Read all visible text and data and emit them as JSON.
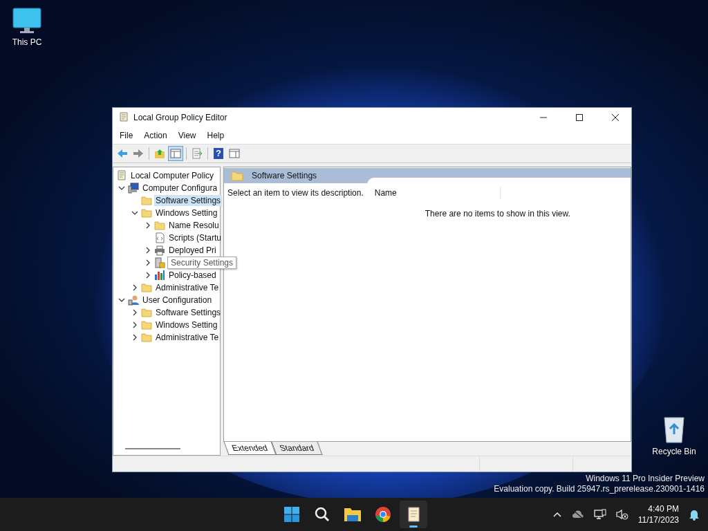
{
  "desktop_icons": [
    {
      "label": "This PC",
      "kind": "monitor"
    },
    {
      "label": "Recycle Bin",
      "kind": "bin"
    }
  ],
  "window": {
    "title": "Local Group Policy Editor",
    "controls": [
      {
        "kind": "minimize"
      },
      {
        "kind": "maximize"
      },
      {
        "kind": "close"
      }
    ]
  },
  "menu": [
    "File",
    "Action",
    "View",
    "Help"
  ],
  "toolbar": [
    [
      {
        "kind": "back",
        "pressed": false
      },
      {
        "kind": "forward",
        "pressed": false
      }
    ],
    [
      {
        "kind": "up",
        "pressed": false
      },
      {
        "kind": "tree",
        "pressed": true
      }
    ],
    [
      {
        "kind": "export",
        "pressed": false
      }
    ],
    [
      {
        "kind": "help",
        "label": "?",
        "pressed": false
      },
      {
        "kind": "pane",
        "pressed": false
      }
    ]
  ],
  "tree": [
    {
      "label": "Local Computer Policy",
      "kind": "policy",
      "selected": false,
      "children": [
        {
          "label": "Computer Configura",
          "kind": "computer",
          "expanded": true,
          "selected": false,
          "children": [
            {
              "label": "Software Settings",
              "kind": "folder",
              "selected": true
            },
            {
              "label": "Windows Setting",
              "kind": "folder",
              "expanded": true,
              "selected": false,
              "children": [
                {
                  "label": "Name Resolu",
                  "kind": "folder",
                  "expanded": false,
                  "selected": false
                },
                {
                  "label": "Scripts (Startu",
                  "kind": "scripts",
                  "selected": false
                },
                {
                  "label": "Deployed Pri",
                  "kind": "printer",
                  "expanded": false,
                  "selected": false
                },
                {
                  "tooltip": "Security Settings",
                  "kind": "security",
                  "expanded": false,
                  "selected": false
                },
                {
                  "label": "Policy-based",
                  "kind": "chart",
                  "expanded": false,
                  "selected": false
                }
              ]
            },
            {
              "label": "Administrative Te",
              "kind": "folder",
              "expanded": false,
              "selected": false
            }
          ]
        },
        {
          "label": "User Configuration",
          "kind": "user",
          "expanded": true,
          "selected": false,
          "children": [
            {
              "label": "Software Settings",
              "kind": "folder",
              "expanded": false,
              "selected": false
            },
            {
              "label": "Windows Setting",
              "kind": "folder",
              "expanded": false,
              "selected": false
            },
            {
              "label": "Administrative Te",
              "kind": "folder",
              "expanded": false,
              "selected": false
            }
          ]
        }
      ]
    }
  ],
  "detail": {
    "header": "Software Settings",
    "description": "Select an item to view its description.",
    "columns": [
      "Name"
    ],
    "empty_message": "There are no items to show in this view."
  },
  "view_tabs": [
    {
      "label": "Extended",
      "selected": true
    },
    {
      "label": "Standard",
      "selected": false
    }
  ],
  "watermark": {
    "line_1": "Windows 11 Pro Insider Preview",
    "line_2": "Evaluation copy. Build 25947.rs_prerelease.230901-1416"
  },
  "taskbar": {
    "apps": [
      {
        "kind": "start",
        "active": false
      },
      {
        "kind": "search",
        "active": false
      },
      {
        "kind": "explorer",
        "active": false
      },
      {
        "kind": "chrome",
        "active": false
      },
      {
        "kind": "gpedit",
        "active": true
      }
    ],
    "tray": [
      {
        "kind": "chevron"
      },
      {
        "kind": "cloud"
      },
      {
        "kind": "network"
      },
      {
        "kind": "volume"
      }
    ],
    "time": "4:40 PM",
    "date": "11/17/2023"
  }
}
